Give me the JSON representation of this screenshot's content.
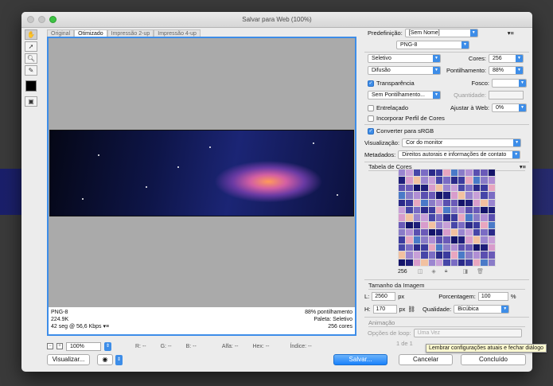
{
  "window": {
    "title": "Salvar para Web (100%)"
  },
  "tabs": [
    "Original",
    "Otimizado",
    "Impressão 2-up",
    "Impressão 4-up"
  ],
  "preview": {
    "format": "PNG-8",
    "size": "224.9K",
    "time": "42 seg @ 56,6 Kbps",
    "dither_info": "88% pontilhamento",
    "palette_info": "Paleta: Seletivo",
    "colors_info": "256 cores"
  },
  "statusbar": {
    "zoom": "100%",
    "r": "R: --",
    "g": "G: --",
    "b": "B: --",
    "alpha": "Alfa: --",
    "hex": "Hex: --",
    "index": "Índice: --"
  },
  "buttons": {
    "preview": "Visualizar...",
    "save": "Salvar...",
    "cancel": "Cancelar",
    "done": "Concluído"
  },
  "panel": {
    "preset_label": "Predefinição:",
    "preset_value": "[Sem Nome]",
    "format": "PNG-8",
    "reduction": "Seletivo",
    "colors_label": "Cores:",
    "colors_value": "256",
    "dither": "Difusão",
    "dither_amount_label": "Pontilhamento:",
    "dither_amount_value": "88%",
    "transparency_label": "Transparência",
    "matte_label": "Fosco:",
    "trans_dither": "Sem Pontilhamento...",
    "amount_label": "Quantidade:",
    "interlaced_label": "Entrelaçado",
    "web_snap_label": "Ajustar à Web:",
    "web_snap_value": "0%",
    "embed_profile_label": "Incorporar Perfil de Cores",
    "convert_srgb_label": "Converter para sRGB",
    "view_label": "Visualização:",
    "view_value": "Cor do monitor",
    "metadata_label": "Metadados:",
    "metadata_value": "Direitos autorais e informações de contato",
    "color_table_title": "Tabela de Cores",
    "color_count": "256",
    "image_size_title": "Tamanho da Imagem",
    "width_label": "L:",
    "width_value": "2560",
    "height_label": "H:",
    "height_value": "170",
    "px": "px",
    "percent_label": "Porcentagem:",
    "percent_value": "100",
    "percent_unit": "%",
    "quality_label": "Qualidade:",
    "quality_value": "Bicúbica",
    "animation_title": "Animação",
    "loop_label": "Opções de loop:",
    "loop_value": "Uma Vez",
    "frame_counter": "1 de 1"
  },
  "tooltip": "Lembrar configurações atuais e fechar diálogo",
  "colors": {
    "accent": "#3d8de8",
    "palette": [
      "#2a2a8a",
      "#3b3b9e",
      "#5a4fb0",
      "#7a6cc4",
      "#9b86d0",
      "#c79fd8",
      "#e8a6c0",
      "#f2c1a0",
      "#14146a",
      "#1e1e7a",
      "#4646a8",
      "#6a5ab8",
      "#8a7cc8",
      "#b08ed4",
      "#d89ccc",
      "#4a7ac8"
    ]
  }
}
